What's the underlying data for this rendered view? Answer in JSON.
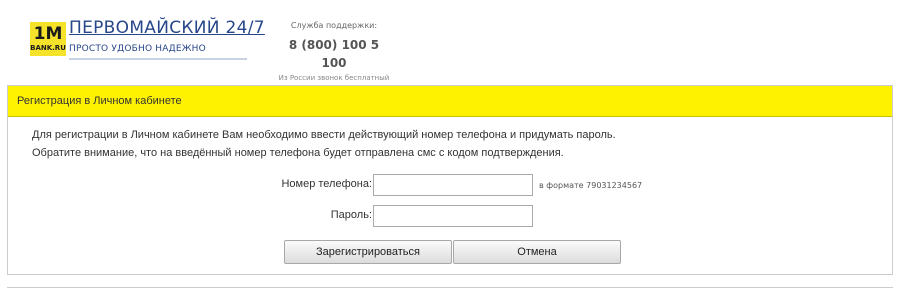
{
  "header": {
    "logo": {
      "main": "1M",
      "sub": "BANK.RU"
    },
    "brand_name": "ПЕРВОМАЙСКИЙ 24/7",
    "tagline": "ПРОСТО  УДОБНО  НАДЕЖНО",
    "support": {
      "title": "Служба поддержки:",
      "phone": "8 (800) 100 5 100",
      "note": "Из России звонок бесплатный"
    }
  },
  "panel": {
    "title": "Регистрация в Личном кабинете",
    "intro_line1": "Для регистрации в Личном кабинете Вам необходимо ввести действующий номер телефона и придумать пароль.",
    "intro_line2": "Обратите внимание, что на введённый номер телефона будет отправлена смс с кодом подтверждения.",
    "phone_label": "Номер телефона:",
    "phone_value": "",
    "phone_hint": "в формате 79031234567",
    "password_label": "Пароль:",
    "password_value": "",
    "register_button": "Зарегистрироваться",
    "cancel_button": "Отмена"
  },
  "colors": {
    "accent_yellow": "#fff200",
    "brand_blue": "#27478a",
    "logo_yellow": "#f5e22a"
  }
}
